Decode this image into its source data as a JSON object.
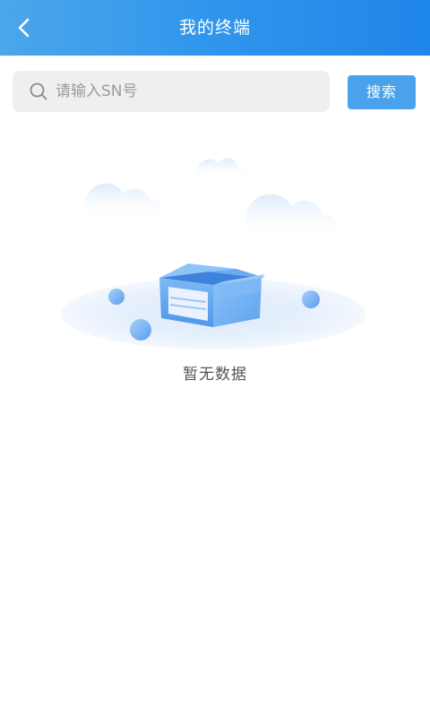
{
  "header": {
    "title": "我的终端",
    "back_icon": "chevron-left-icon",
    "background_colors": [
      "#4ca6ea",
      "#1f86ea"
    ]
  },
  "search": {
    "placeholder": "请输入SN号",
    "value": "",
    "icon": "search-icon",
    "button_label": "搜索",
    "button_color": "#4aa3ea"
  },
  "empty_state": {
    "illustration": "empty-box-illustration",
    "message": "暂无数据"
  }
}
